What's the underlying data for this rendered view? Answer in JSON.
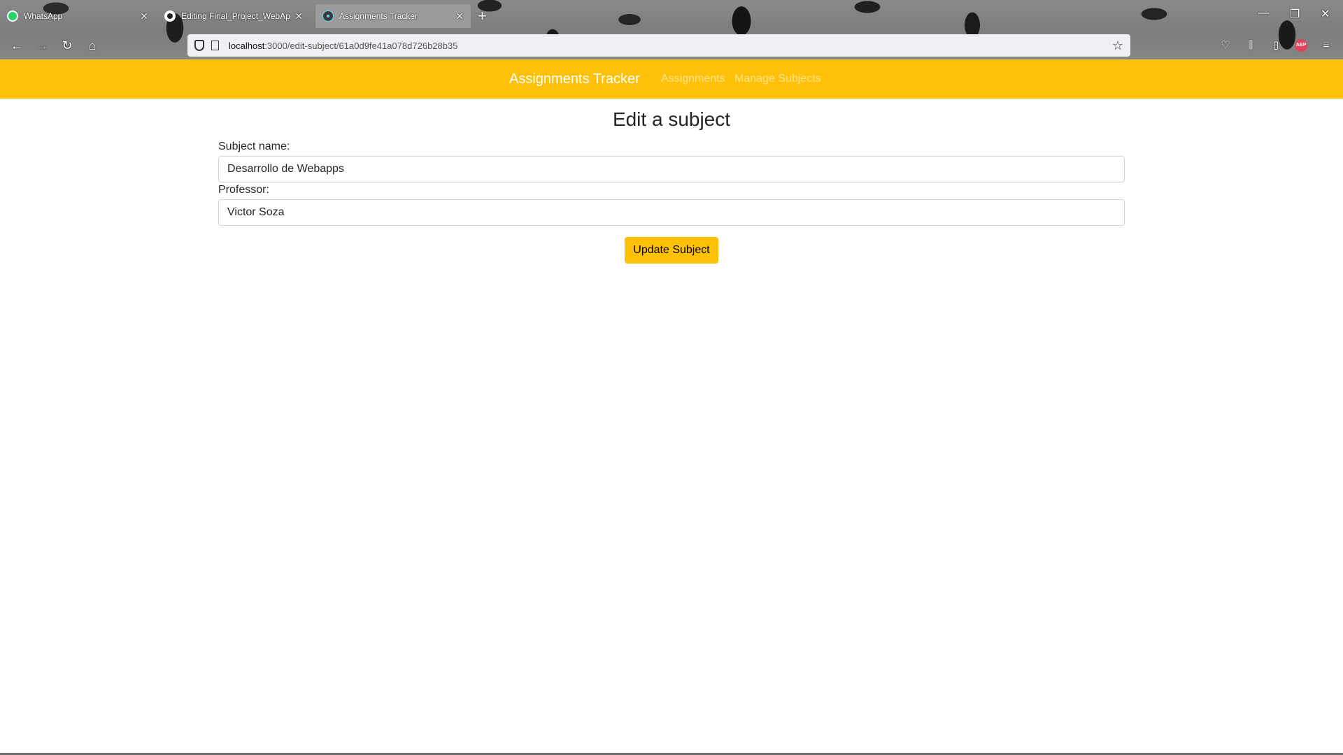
{
  "browser": {
    "tabs": [
      {
        "title": "WhatsApp",
        "icon": "whatsapp-icon"
      },
      {
        "title": "Editing Final_Project_WebApp/",
        "icon": "github-icon"
      },
      {
        "title": "Assignments Tracker",
        "icon": "react-icon",
        "active": true
      }
    ],
    "url_host": "localhost",
    "url_path": ":3000/edit-subject/61a0d9fe41a078d726b28b35"
  },
  "navbar": {
    "brand": "Assignments Tracker",
    "links": [
      "Assignments",
      "Manage Subjects"
    ],
    "accent_color": "#ffc107"
  },
  "form": {
    "heading": "Edit a subject",
    "subject_label": "Subject name:",
    "subject_value": "Desarrollo de Webapps",
    "professor_label": "Professor:",
    "professor_value": "Victor Soza",
    "submit_label": "Update Subject"
  }
}
